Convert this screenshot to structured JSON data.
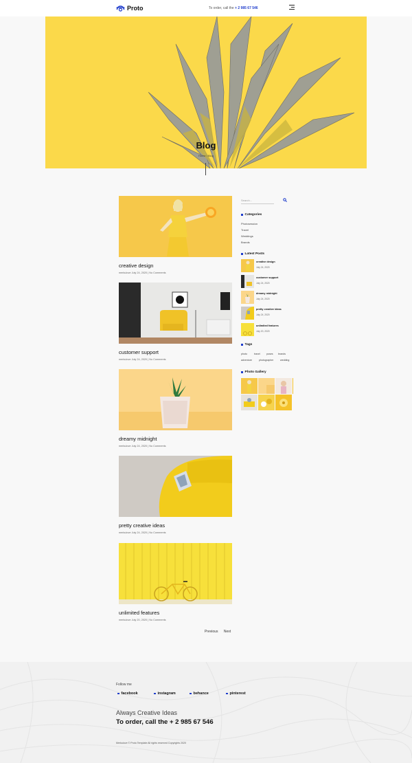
{
  "header": {
    "logo_text": "Proto",
    "phone_prefix": "To order, call the",
    "phone_number": "+ 2 985 67 546"
  },
  "hero": {
    "title": "Blog",
    "breadcrumb": "Home / Blog"
  },
  "posts": [
    {
      "title": "creative design",
      "meta": "merkulove July 24, 2020 | No Comments"
    },
    {
      "title": "customer support",
      "meta": "merkulove July 24, 2020 | No Comments"
    },
    {
      "title": "dreamy midnight",
      "meta": "merkulove July 24, 2020 | No Comments"
    },
    {
      "title": "pretty creative ideas",
      "meta": "merkulove July 24, 2020 | No Comments"
    },
    {
      "title": "unlimited features",
      "meta": "merkulove July 20, 2020 | No Comments"
    }
  ],
  "pagination": {
    "previous": "Previous",
    "next": "Next"
  },
  "sidebar": {
    "search_placeholder": "Search...",
    "categories_title": "Categories",
    "categories": [
      "Photosession",
      "Travel",
      "Weddings",
      "Brands"
    ],
    "latest_title": "Latest Posts",
    "latest": [
      {
        "title": "creative design",
        "date": "July 24, 2020"
      },
      {
        "title": "customer support",
        "date": "July 24, 2020"
      },
      {
        "title": "dreamy midnight",
        "date": "July 24, 2020"
      },
      {
        "title": "pretty creative ideas",
        "date": "July 24, 2020"
      },
      {
        "title": "unlimited features",
        "date": "July 20, 2020"
      }
    ],
    "tags_title": "Tags",
    "tags": [
      "photo",
      "travel",
      "poses",
      "brands",
      "adventure",
      "photographer",
      "wedding"
    ],
    "gallery_title": "Photo Gallery"
  },
  "footer": {
    "follow": "Follow me",
    "social": [
      "facebook",
      "instagram",
      "behance",
      "pinterest"
    ],
    "tagline": "Always Creative Ideas",
    "cta": "To order, call the + 2 985 67 546",
    "copyright": "Merkulove © Proto Template All rights reserved Copyrights 2020"
  },
  "colors": {
    "accent": "#1f3dcc",
    "yellow": "#fbd94a",
    "background": "#f8f8f8"
  }
}
